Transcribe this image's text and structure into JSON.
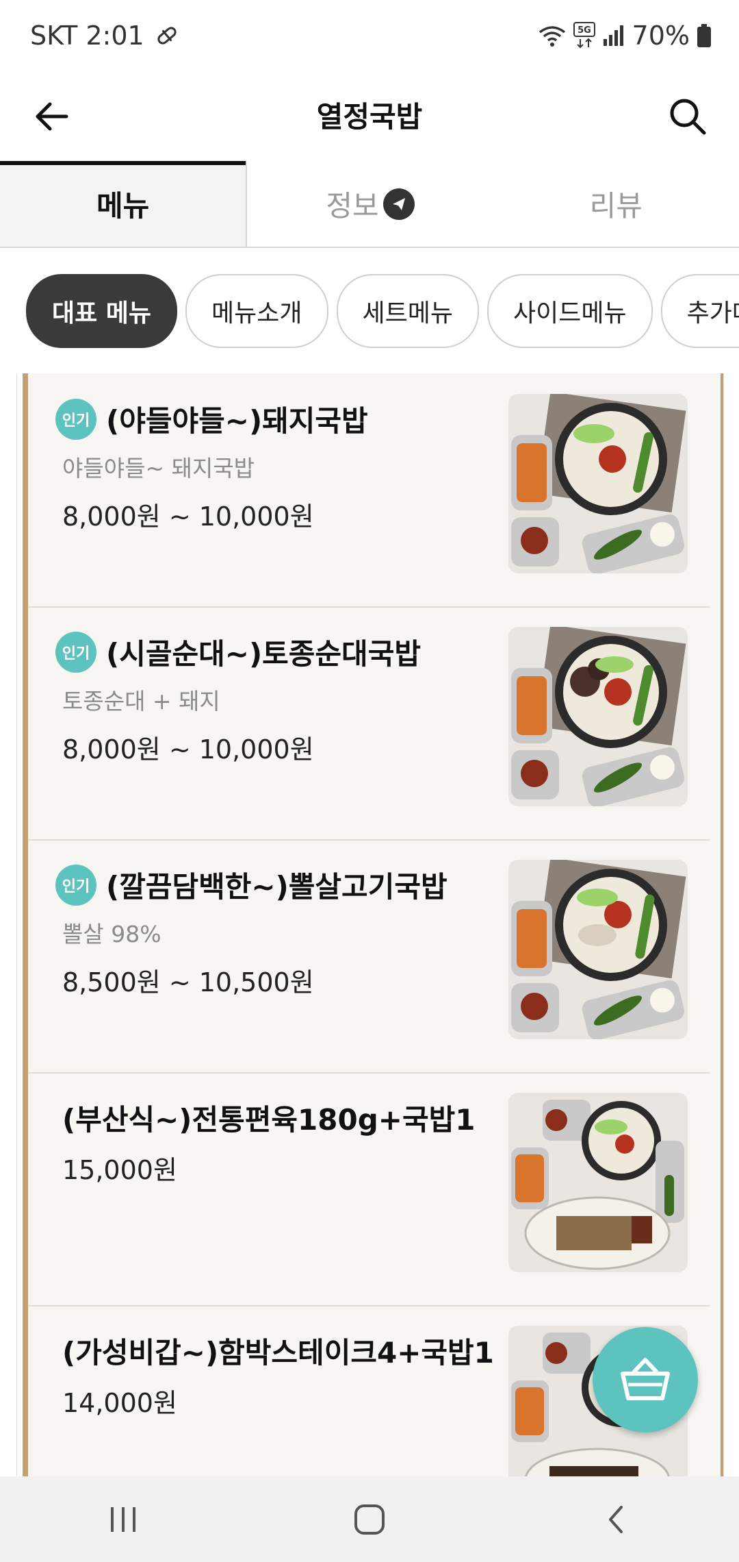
{
  "status_bar": {
    "carrier_time": "SKT 2:01",
    "battery": "70%",
    "network": "5G"
  },
  "app_bar": {
    "title": "열정국밥"
  },
  "tabs": [
    {
      "label": "메뉴",
      "active": true
    },
    {
      "label": "정보",
      "active": false
    },
    {
      "label": "리뷰",
      "active": false
    }
  ],
  "categories": [
    {
      "label": "대표 메뉴",
      "active": true
    },
    {
      "label": "메뉴소개",
      "active": false
    },
    {
      "label": "세트메뉴",
      "active": false
    },
    {
      "label": "사이드메뉴",
      "active": false
    },
    {
      "label": "추가메뉴",
      "active": false
    }
  ],
  "menu_items": [
    {
      "badge": "인기",
      "name": "(야들야들~)돼지국밥",
      "description": "야들야들~ 돼지국밥",
      "price": "8,000원 ~ 10,000원",
      "image": "pork-gukbap-photo"
    },
    {
      "badge": "인기",
      "name": "(시골순대~)토종순대국밥",
      "description": "토종순대 + 돼지",
      "price": "8,000원 ~ 10,000원",
      "image": "sundae-gukbap-photo"
    },
    {
      "badge": "인기",
      "name": "(깔끔담백한~)뽈살고기국밥",
      "description": "뽈살 98%",
      "price": "8,500원 ~ 10,500원",
      "image": "cheek-meat-gukbap-photo"
    },
    {
      "badge": "",
      "name": "(부산식~)전통편육180g+국밥1",
      "description": "",
      "price": "15,000원",
      "image": "pyeonyuk-set-photo"
    },
    {
      "badge": "",
      "name": "(가성비갑~)함박스테이크4+국밥1",
      "description": "",
      "price": "14,000원",
      "image": "hamburg-steak-set-photo"
    }
  ],
  "colors": {
    "accent": "#5cc3be",
    "frame": "#c3a176",
    "active_chip": "#3a3a3a"
  },
  "icons": [
    "back-arrow-icon",
    "search-icon",
    "wifi-icon",
    "signal-icon",
    "battery-icon",
    "info-badge-icon",
    "cart-icon",
    "recents-icon",
    "home-icon",
    "nav-back-icon"
  ]
}
